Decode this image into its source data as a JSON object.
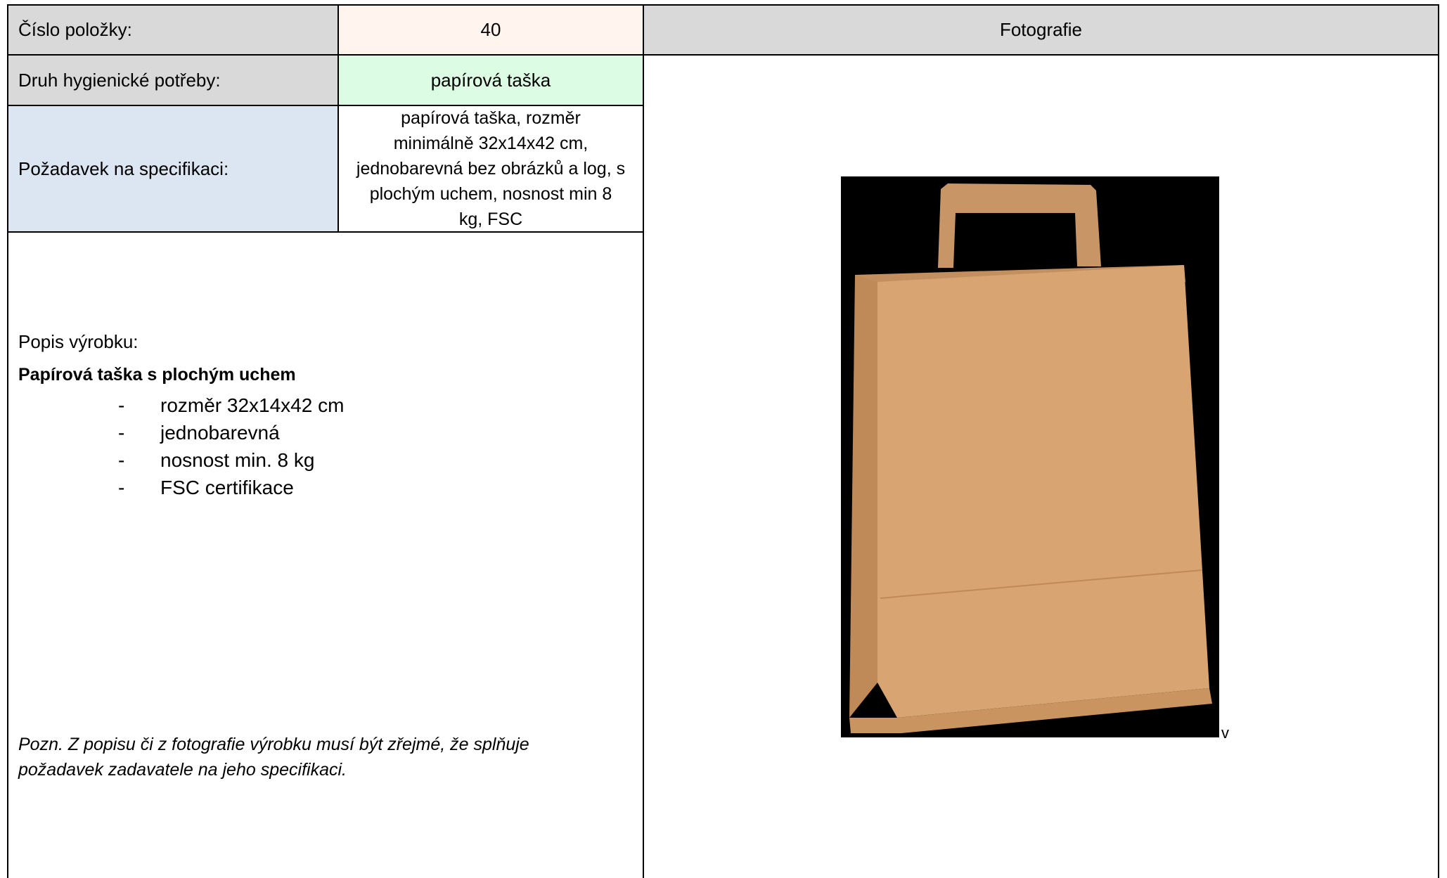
{
  "table": {
    "item_number_label": "Číslo položky:",
    "item_number_value": "40",
    "photo_header": "Fotografie",
    "type_label": "Druh hygienické potřeby:",
    "type_value": "papírová taška",
    "spec_label": "Požadavek na specifikaci:",
    "spec_value_lines": [
      "papírová taška, rozměr",
      "minimálně 32x14x42 cm,",
      "jednobarevná bez obrázků a log, s",
      "plochým uchem, nosnost min 8",
      "kg, FSC"
    ]
  },
  "description": {
    "title": "Popis výrobku:",
    "product_name": "Papírová taška s plochým uchem",
    "bullet_marker": "-",
    "bullets": [
      "rozměr 32x14x42 cm",
      "jednobarevná",
      "nosnost min. 8 kg",
      "FSC certifikace"
    ],
    "note_lines": [
      "Pozn. Z popisu či z fotografie výrobku musí být zřejmé, že splňuje",
      "požadavek zadavatele na jeho specifikaci."
    ]
  },
  "photo": {
    "subject": "paper-bag-icon",
    "trailing_mark": "v",
    "colors": {
      "background": "#000000",
      "paper": "#d7a472",
      "paper_shade": "#c48f5e"
    }
  }
}
